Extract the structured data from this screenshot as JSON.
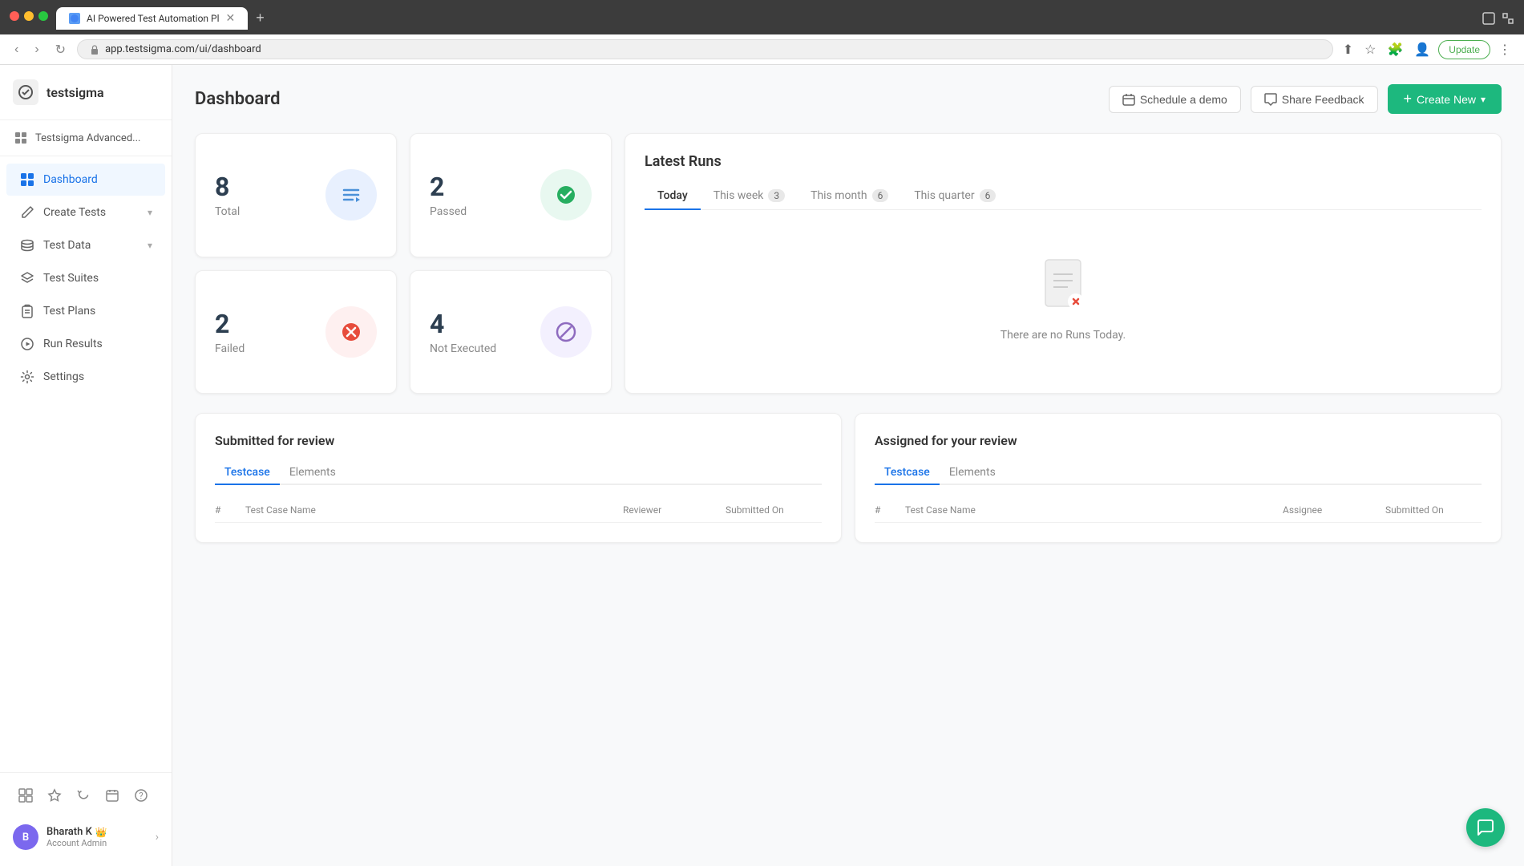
{
  "browser": {
    "tab_title": "AI Powered Test Automation Pl",
    "url": "app.testsigma.com/ui/dashboard",
    "update_label": "Update"
  },
  "sidebar": {
    "logo_text": "testsigma",
    "workspace_label": "Testsigma Advanced...",
    "nav_items": [
      {
        "id": "dashboard",
        "label": "Dashboard",
        "icon": "dashboard",
        "active": true
      },
      {
        "id": "create-tests",
        "label": "Create Tests",
        "icon": "pencil",
        "hasChevron": true
      },
      {
        "id": "test-data",
        "label": "Test Data",
        "icon": "database",
        "hasChevron": true
      },
      {
        "id": "test-suites",
        "label": "Test Suites",
        "icon": "layers"
      },
      {
        "id": "test-plans",
        "label": "Test Plans",
        "icon": "clipboard"
      },
      {
        "id": "run-results",
        "label": "Run Results",
        "icon": "play"
      },
      {
        "id": "settings",
        "label": "Settings",
        "icon": "gear"
      }
    ],
    "user": {
      "name": "Bharath K",
      "role": "Account Admin",
      "avatar_initials": "B"
    }
  },
  "header": {
    "title": "Dashboard",
    "schedule_demo_label": "Schedule a demo",
    "share_feedback_label": "Share Feedback",
    "create_new_label": "Create New"
  },
  "stats": {
    "total": {
      "number": "8",
      "label": "Total"
    },
    "passed": {
      "number": "2",
      "label": "Passed"
    },
    "failed": {
      "number": "2",
      "label": "Failed"
    },
    "not_executed": {
      "number": "4",
      "label": "Not Executed"
    }
  },
  "latest_runs": {
    "title": "Latest Runs",
    "tabs": [
      {
        "id": "today",
        "label": "Today",
        "count": null,
        "active": true
      },
      {
        "id": "this-week",
        "label": "This week",
        "count": "3"
      },
      {
        "id": "this-month",
        "label": "This month",
        "count": "6"
      },
      {
        "id": "this-quarter",
        "label": "This quarter",
        "count": "6"
      }
    ],
    "empty_message": "There are no Runs Today."
  },
  "submitted_review": {
    "title": "Submitted for review",
    "tabs": [
      {
        "id": "testcase",
        "label": "Testcase",
        "active": true
      },
      {
        "id": "elements",
        "label": "Elements"
      }
    ],
    "columns": [
      "#",
      "Test Case Name",
      "Reviewer",
      "Submitted On"
    ]
  },
  "assigned_review": {
    "title": "Assigned for your review",
    "tabs": [
      {
        "id": "testcase",
        "label": "Testcase",
        "active": true
      },
      {
        "id": "elements",
        "label": "Elements"
      }
    ],
    "columns": [
      "#",
      "Test Case Name",
      "Assignee",
      "Submitted On"
    ]
  }
}
